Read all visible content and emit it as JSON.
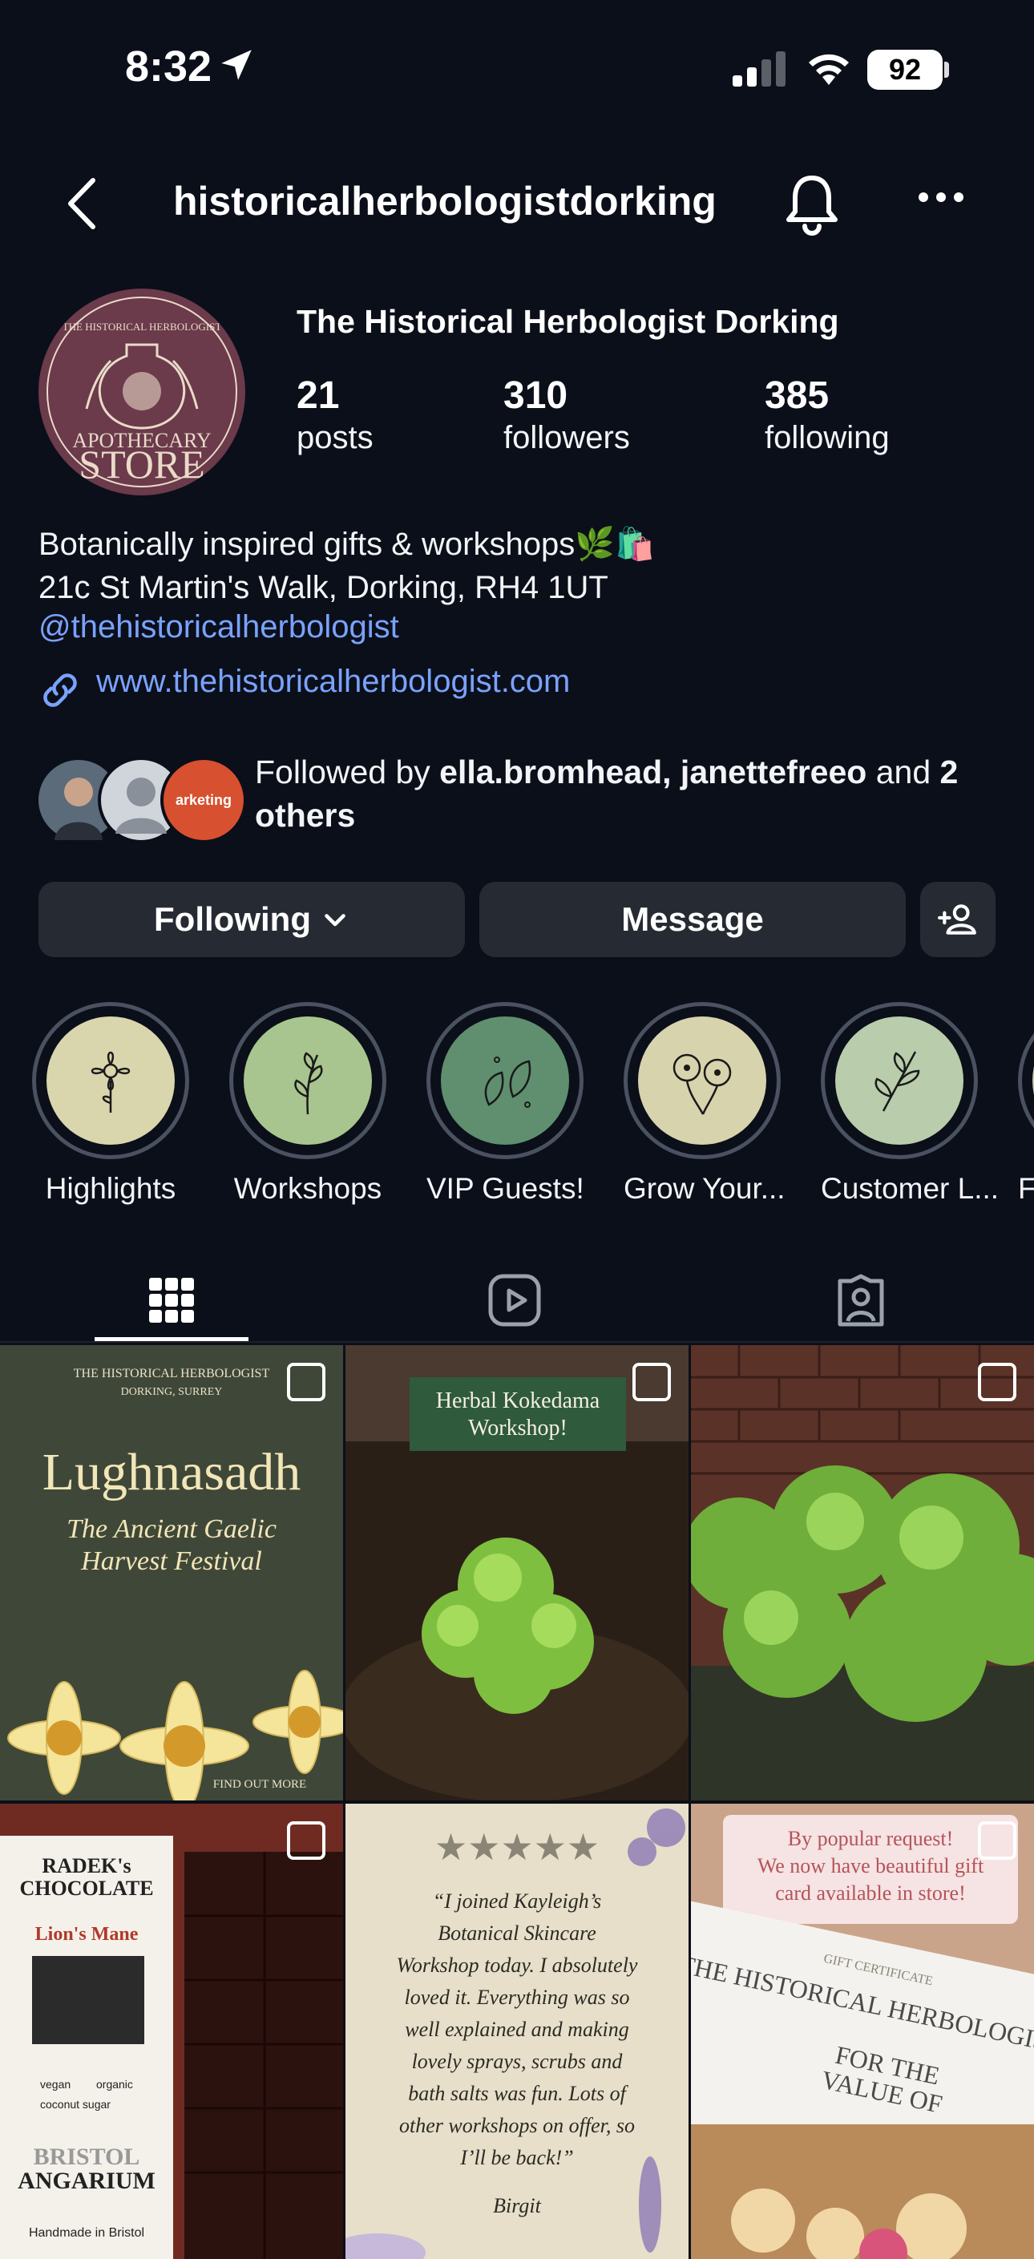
{
  "status_bar": {
    "time": "8:32",
    "battery": "92"
  },
  "header": {
    "username": "historicalherbologistdorking"
  },
  "profile": {
    "avatar_text": {
      "line1": "THE HISTORICAL HERBOLOGIST",
      "line2": "APOTHECARY",
      "line3": "STORE"
    },
    "display_name": "The Historical Herbologist Dorking",
    "stats": {
      "posts": {
        "count": "21",
        "label": "posts"
      },
      "followers": {
        "count": "310",
        "label": "followers"
      },
      "following": {
        "count": "385",
        "label": "following"
      }
    },
    "bio": {
      "line1": "Botanically inspired gifts & workshops🌿🛍️",
      "line2": "21c St Martin's Walk, Dorking, RH4 1UT",
      "mention": "@thehistoricalherbologist",
      "link": "www.thehistoricalherbologist.com"
    },
    "followed_by": {
      "prefix": "Followed by ",
      "names": "ella.bromhead, janettefreeo",
      "joiner": " and ",
      "others": "2 others",
      "avatar3_text": "arketing"
    }
  },
  "actions": {
    "following_label": "Following",
    "message_label": "Message"
  },
  "highlights": [
    {
      "label": "Highlights",
      "color": "#d9d6ad"
    },
    {
      "label": "Workshops",
      "color": "#a9c58f"
    },
    {
      "label": "VIP Guests!",
      "color": "#5f8f6f"
    },
    {
      "label": "Grow Your...",
      "color": "#d7d3ad"
    },
    {
      "label": "Customer L...",
      "color": "#b9ccab"
    },
    {
      "label": "Fo",
      "color": "#c9c6ad"
    }
  ],
  "posts": [
    {
      "lines": [
        "THE HISTORICAL HERBOLOGIST",
        "DORKING, SURREY",
        "Lughnasadh",
        "The Ancient Gaelic",
        "Harvest Festival",
        "FIND OUT MORE"
      ]
    },
    {
      "lines": [
        "Herbal Kokedama",
        "Workshop!"
      ]
    },
    {
      "lines": []
    },
    {
      "lines": [
        "RADEK's",
        "CHOCOLATE",
        "Lion's Mane",
        "vegan",
        "organic",
        "coconut sugar",
        "BRISTOL",
        "ANGARIUM",
        "Handmade in Bristol"
      ]
    },
    {
      "lines": [
        "★★★★★",
        "“I joined Kayleigh’s",
        "Botanical Skincare",
        "Workshop today. I absolutely",
        "loved it. Everything was so",
        "well explained and making",
        "lovely sprays, scrubs and",
        "bath salts was fun. Lots of",
        "other workshops on offer, so",
        "I’ll be back!”",
        "Birgit"
      ]
    },
    {
      "lines": [
        "By popular request!",
        "We now have beautiful gift",
        "card available in store!",
        "GIFT CERTIFICATE",
        "THE HISTORICAL HERBOLOGIST",
        "FOR THE",
        "VALUE OF"
      ]
    }
  ]
}
